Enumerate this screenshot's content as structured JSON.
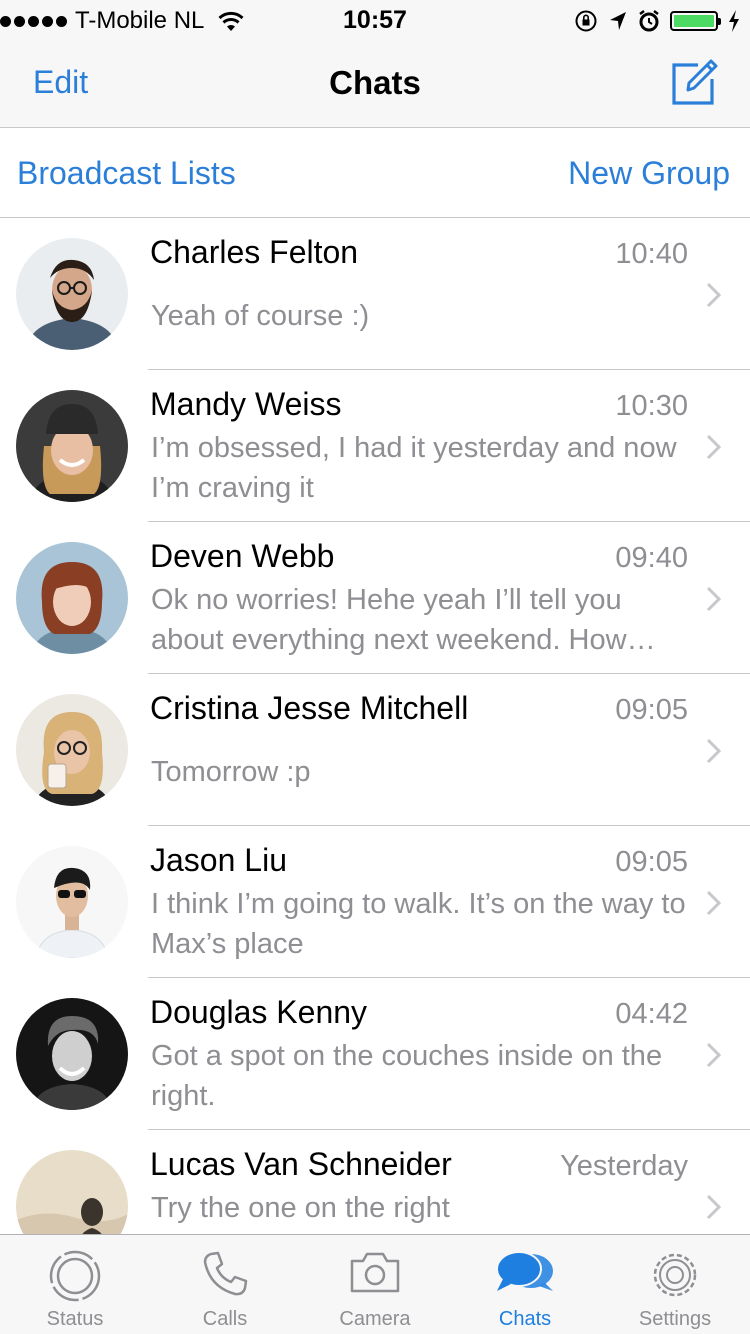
{
  "status_bar": {
    "carrier": "T-Mobile NL",
    "time": "10:57",
    "signal_bars": 5,
    "battery_level": 1.0,
    "icons": [
      "wifi-icon",
      "rotation-lock-icon",
      "location-arrow-icon",
      "alarm-icon",
      "battery-icon",
      "charging-bolt-icon"
    ]
  },
  "nav": {
    "edit_label": "Edit",
    "title": "Chats",
    "compose_icon": "compose-icon"
  },
  "links": {
    "broadcast": "Broadcast Lists",
    "new_group": "New Group"
  },
  "chats": [
    {
      "name": "Charles Felton",
      "time": "10:40",
      "message": "Yeah of course :)"
    },
    {
      "name": "Mandy Weiss",
      "time": "10:30",
      "message": "I’m obsessed, I had it yesterday and now I’m craving it"
    },
    {
      "name": "Deven Webb",
      "time": "09:40",
      "message": "Ok no worries! Hehe yeah I’ll tell you about everything next weekend. How…"
    },
    {
      "name": "Cristina Jesse Mitchell",
      "time": "09:05",
      "message": "Tomorrow :p"
    },
    {
      "name": "Jason Liu",
      "time": "09:05",
      "message": "I think I’m going to walk. It’s on the way to Max’s place"
    },
    {
      "name": "Douglas Kenny",
      "time": "04:42",
      "message": "Got a spot on the couches inside on the right."
    },
    {
      "name": "Lucas Van Schneider",
      "time": "Yesterday",
      "message": "Try the one on the right"
    }
  ],
  "tabs": [
    {
      "label": "Status",
      "icon": "status-icon",
      "active": false
    },
    {
      "label": "Calls",
      "icon": "phone-icon",
      "active": false
    },
    {
      "label": "Camera",
      "icon": "camera-icon",
      "active": false
    },
    {
      "label": "Chats",
      "icon": "chats-icon",
      "active": true
    },
    {
      "label": "Settings",
      "icon": "gear-icon",
      "active": false
    }
  ],
  "colors": {
    "accent": "#2b7fd9",
    "secondary_text": "#8e8e93",
    "battery": "#4cd964",
    "bar_background": "#f7f7f7"
  }
}
